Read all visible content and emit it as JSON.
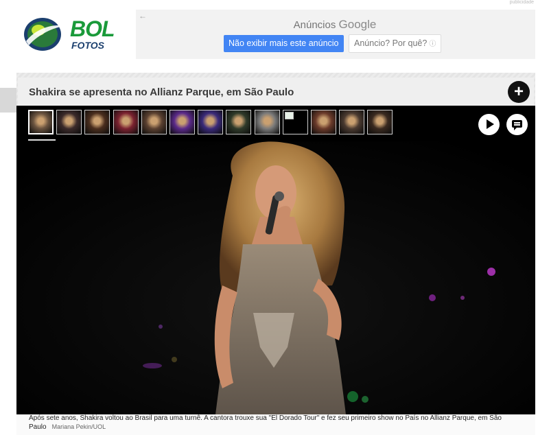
{
  "header": {
    "publicidade": "publicidade",
    "logo_bol": "BOL",
    "logo_fotos": "FOTOS"
  },
  "ad": {
    "back_arrow": "←",
    "title_prefix": "Anúncios",
    "title_brand": "Google",
    "hide_button": "Não exibir mais este anúncio",
    "why_button": "Anúncio? Por quê?",
    "info_glyph": "ⓘ"
  },
  "gallery": {
    "title": "Shakira se apresenta no Allianz Parque, em São Paulo",
    "plus_glyph": "+",
    "thumbnails": [
      {
        "tone": "#6b5440",
        "active": true
      },
      {
        "tone": "#3b2a2a"
      },
      {
        "tone": "#4a2e1e"
      },
      {
        "tone": "#7a2230"
      },
      {
        "tone": "#5a4030"
      },
      {
        "tone": "#5b2a8a"
      },
      {
        "tone": "#3a2a7a"
      },
      {
        "tone": "#2f3a2a"
      },
      {
        "tone": "#7a7a7a"
      },
      {
        "tone": "#000000",
        "broken": true
      },
      {
        "tone": "#6a3a2a"
      },
      {
        "tone": "#4a3a30"
      },
      {
        "tone": "#3a2a20"
      }
    ],
    "caption": "Após sete anos, Shakira voltou ao Brasil para uma turnê. A cantora trouxe sua \"El Dorado Tour\" e fez seu primeiro show no País no Allianz Parque, em São Paulo",
    "credit": "Mariana Pekin/UOL"
  },
  "colors": {
    "brand_green": "#1a9a3a",
    "brand_blue": "#1b3f6e",
    "ad_blue": "#4285f4",
    "stage_bg": "#000000"
  },
  "icons": {
    "logo": "bol-globe-logo-icon",
    "back": "back-arrow-icon",
    "info": "info-icon",
    "plus": "plus-icon",
    "play": "play-icon",
    "caption": "caption-bubble-icon"
  }
}
